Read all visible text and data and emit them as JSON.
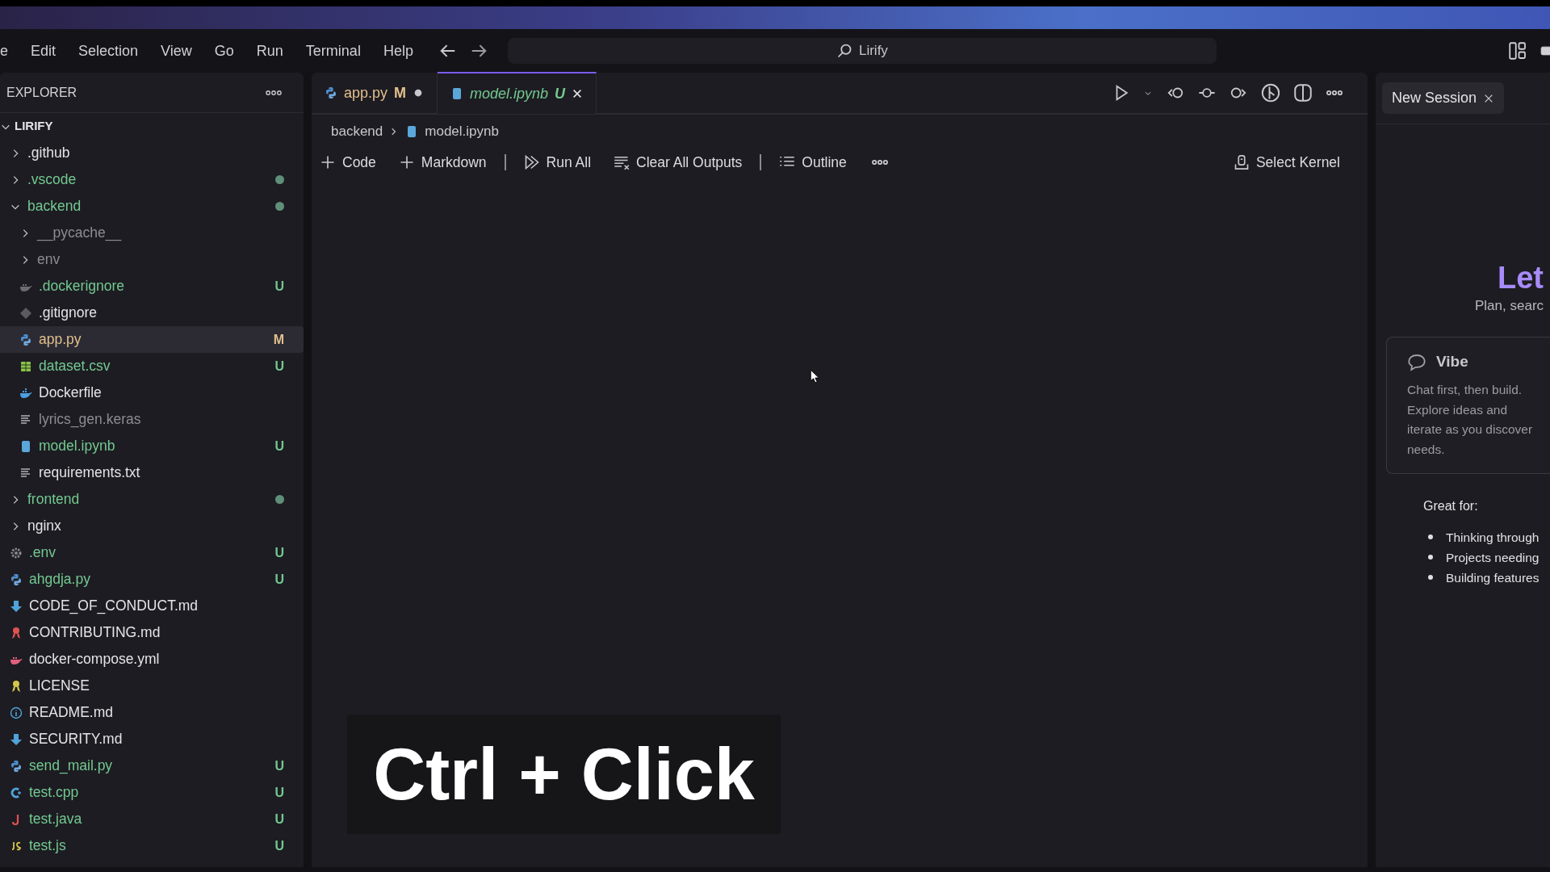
{
  "menu": [
    "e",
    "Edit",
    "Selection",
    "View",
    "Go",
    "Run",
    "Terminal",
    "Help"
  ],
  "search": {
    "value": "Lirify"
  },
  "explorer": {
    "title": "EXPLORER",
    "root": {
      "name": "LIRIFY",
      "expanded": true,
      "children": [
        {
          "name": ".github",
          "kind": "folder",
          "expanded": false,
          "color": "#e4e4e7",
          "selected": false
        },
        {
          "name": ".vscode",
          "kind": "folder",
          "expanded": false,
          "color": "#73c991",
          "dot": true,
          "selected": false
        },
        {
          "name": "backend",
          "kind": "folder",
          "expanded": true,
          "color": "#73c991",
          "dot": true,
          "selected": false,
          "children": [
            {
              "name": "__pycache__",
              "kind": "folder",
              "expanded": false,
              "color": "#8c8c92",
              "selected": false
            },
            {
              "name": "env",
              "kind": "folder",
              "expanded": false,
              "color": "#8c8c92",
              "selected": false
            },
            {
              "name": ".dockerignore",
              "kind": "dockerignore",
              "color": "#73c991",
              "badge": "U",
              "selected": false
            },
            {
              "name": ".gitignore",
              "kind": "gitignore",
              "color": "#e4e4e7",
              "selected": false
            },
            {
              "name": "app.py",
              "kind": "python",
              "color": "#e2c08d",
              "badge": "M",
              "selected": true
            },
            {
              "name": "dataset.csv",
              "kind": "csv",
              "color": "#73c991",
              "badge": "U",
              "selected": false
            },
            {
              "name": "Dockerfile",
              "kind": "dockerfile",
              "color": "#e4e4e7",
              "selected": false
            },
            {
              "name": "lyrics_gen.keras",
              "kind": "text",
              "color": "#8c8c92",
              "selected": false
            },
            {
              "name": "model.ipynb",
              "kind": "notebook",
              "color": "#73c991",
              "badge": "U",
              "selected": false
            },
            {
              "name": "requirements.txt",
              "kind": "text",
              "color": "#e4e4e7",
              "selected": false
            }
          ]
        },
        {
          "name": "frontend",
          "kind": "folder",
          "expanded": false,
          "color": "#73c991",
          "dot": true,
          "selected": false
        },
        {
          "name": "nginx",
          "kind": "folder",
          "expanded": false,
          "color": "#e4e4e7",
          "selected": false
        },
        {
          "name": ".env",
          "kind": "env",
          "color": "#73c991",
          "badge": "U",
          "selected": false
        },
        {
          "name": "ahgdja.py",
          "kind": "python",
          "color": "#73c991",
          "badge": "U",
          "selected": false
        },
        {
          "name": "CODE_OF_CONDUCT.md",
          "kind": "markdown",
          "color": "#e4e4e7",
          "selected": false
        },
        {
          "name": "CONTRIBUTING.md",
          "kind": "contributing",
          "color": "#e4e4e7",
          "selected": false
        },
        {
          "name": "docker-compose.yml",
          "kind": "compose",
          "color": "#e4e4e7",
          "selected": false
        },
        {
          "name": "LICENSE",
          "kind": "license",
          "color": "#e4e4e7",
          "selected": false
        },
        {
          "name": "README.md",
          "kind": "readme",
          "color": "#e4e4e7",
          "selected": false
        },
        {
          "name": "SECURITY.md",
          "kind": "markdown",
          "color": "#e4e4e7",
          "selected": false
        },
        {
          "name": "send_mail.py",
          "kind": "python",
          "color": "#73c991",
          "badge": "U",
          "selected": false
        },
        {
          "name": "test.cpp",
          "kind": "cpp",
          "color": "#73c991",
          "badge": "U",
          "selected": false
        },
        {
          "name": "test.java",
          "kind": "java",
          "color": "#73c991",
          "badge": "U",
          "selected": false
        },
        {
          "name": "test.js",
          "kind": "js",
          "color": "#73c991",
          "badge": "U",
          "selected": false
        }
      ]
    }
  },
  "tabs": [
    {
      "label": "app.py",
      "kind": "python",
      "color": "#e2c08d",
      "badge": "M",
      "dirty": true,
      "preview": false,
      "selected": false
    },
    {
      "label": "model.ipynb",
      "kind": "notebook",
      "color": "#73c991",
      "badge": "U",
      "dirty": false,
      "preview": true,
      "selected": true
    }
  ],
  "breadcrumb": [
    "backend",
    "model.ipynb"
  ],
  "notebook_toolbar": [
    {
      "kind": "add",
      "label": "Code"
    },
    {
      "kind": "add",
      "label": "Markdown"
    },
    {
      "kind": "separator"
    },
    {
      "kind": "run-all",
      "label": "Run All"
    },
    {
      "kind": "clear",
      "label": "Clear All Outputs"
    },
    {
      "kind": "separator"
    },
    {
      "kind": "outline",
      "label": "Outline"
    },
    {
      "kind": "more"
    }
  ],
  "kernel": "Select Kernel",
  "chat": {
    "tab": "New Session",
    "heading": "Let",
    "subtitle": "Plan, searc",
    "card": {
      "title": "Vibe",
      "text": "Chat first, then build. Explore ideas and iterate as you discover needs."
    },
    "great_for": "Great for:",
    "bullets": [
      "Thinking through",
      "Projects needing",
      "Building features"
    ]
  },
  "caption": "Ctrl + Click"
}
